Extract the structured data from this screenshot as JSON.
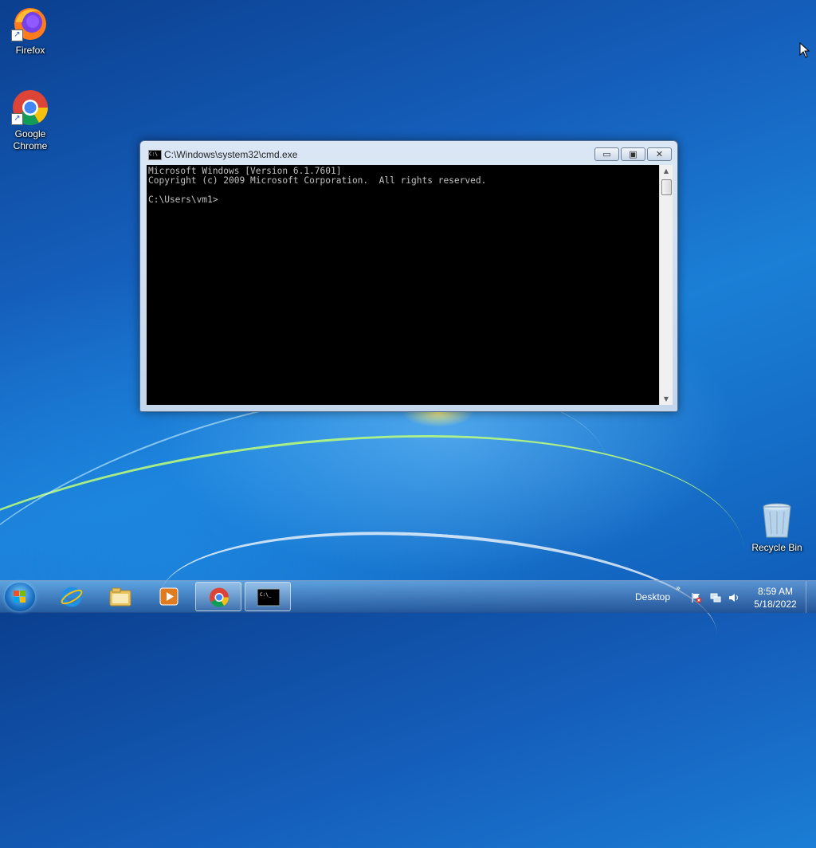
{
  "desktop": {
    "icons": [
      {
        "label": "Firefox",
        "icon": "firefox-icon"
      },
      {
        "label": "Google Chrome",
        "icon": "chrome-icon"
      },
      {
        "label": "Recycle Bin",
        "icon": "recycle-bin-icon"
      }
    ]
  },
  "window": {
    "title": "C:\\Windows\\system32\\cmd.exe",
    "title_icon_text": "C:\\",
    "buttons": {
      "minimize": "▭",
      "maximize": "▣",
      "close": "✕"
    },
    "console_text": "Microsoft Windows [Version 6.1.7601]\nCopyright (c) 2009 Microsoft Corporation.  All rights reserved.\n\nC:\\Users\\vm1>"
  },
  "taskbar": {
    "items": [
      {
        "name": "internet-explorer",
        "icon": "internet-explorer-icon"
      },
      {
        "name": "windows-explorer",
        "icon": "folder-icon"
      },
      {
        "name": "media-player",
        "icon": "media-player-icon"
      },
      {
        "name": "chrome",
        "icon": "chrome-icon"
      },
      {
        "name": "cmd",
        "icon": "cmd-icon"
      }
    ],
    "desktop_toolbar": "Desktop",
    "chevron": "»",
    "clock": {
      "time": "8:59 AM",
      "date": "5/18/2022"
    }
  },
  "colors": {
    "accent": "#1b7fd6",
    "console_bg": "#000000",
    "console_text": "#c0c0c0"
  }
}
